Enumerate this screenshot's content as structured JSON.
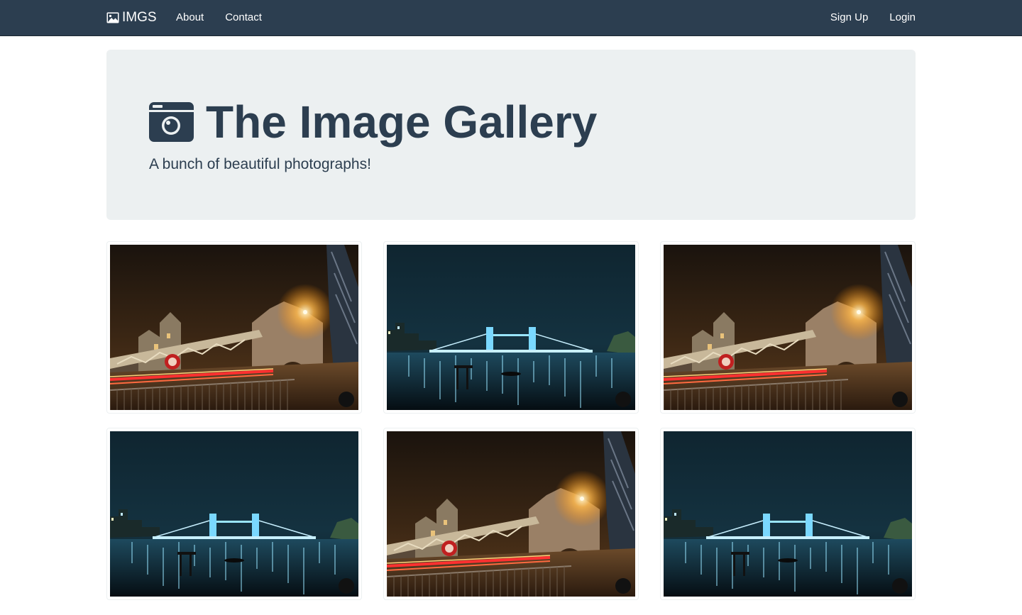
{
  "navbar": {
    "brand": "IMGS",
    "brand_icon": "picture-icon",
    "left_links": [
      "About",
      "Contact"
    ],
    "right_links": [
      "Sign Up",
      "Login"
    ],
    "background": "#2c3e50"
  },
  "jumbotron": {
    "title": "The Image Gallery",
    "title_icon": "camera-icon",
    "subtitle": "A bunch of beautiful photographs!",
    "background": "#ecf0f1"
  },
  "gallery": {
    "photos": [
      {
        "scene": "tower-bridge-closeup-night"
      },
      {
        "scene": "tower-bridge-river-night"
      },
      {
        "scene": "tower-bridge-closeup-night"
      },
      {
        "scene": "tower-bridge-river-night"
      },
      {
        "scene": "tower-bridge-closeup-night"
      },
      {
        "scene": "tower-bridge-river-night"
      }
    ]
  }
}
